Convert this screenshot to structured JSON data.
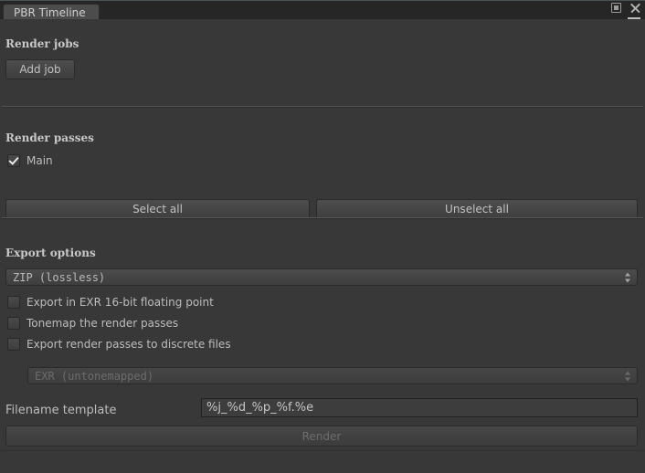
{
  "window": {
    "tab_label": "PBR Timeline",
    "maximize_icon": "maximize-icon",
    "close_icon": "close-icon",
    "menu_caret_icon": "chevron-down-icon",
    "menu_icon": "hamburger-menu-icon",
    "background_color": "#383838",
    "tab_active_color": "#4c4c4c"
  },
  "render_jobs": {
    "heading": "Render jobs",
    "add_job_label": "Add job"
  },
  "render_passes": {
    "heading": "Render passes",
    "passes": [
      {
        "label": "Main",
        "checked": true
      }
    ],
    "select_all_label": "Select all",
    "unselect_all_label": "Unselect all"
  },
  "export_options": {
    "heading": "Export options",
    "archive_format": {
      "value": "ZIP (lossless)",
      "enabled": true
    },
    "toggles": [
      {
        "label": "Export in EXR 16-bit floating point",
        "checked": false
      },
      {
        "label": "Tonemap the render passes",
        "checked": false
      },
      {
        "label": "Export render passes to discrete files",
        "checked": false
      }
    ],
    "discrete_format": {
      "value": "EXR (untonemapped)",
      "enabled": false
    },
    "filename_template": {
      "label": "Filename template",
      "value": "%j_%d_%p_%f.%e"
    },
    "render_label": "Render",
    "render_enabled": false
  }
}
